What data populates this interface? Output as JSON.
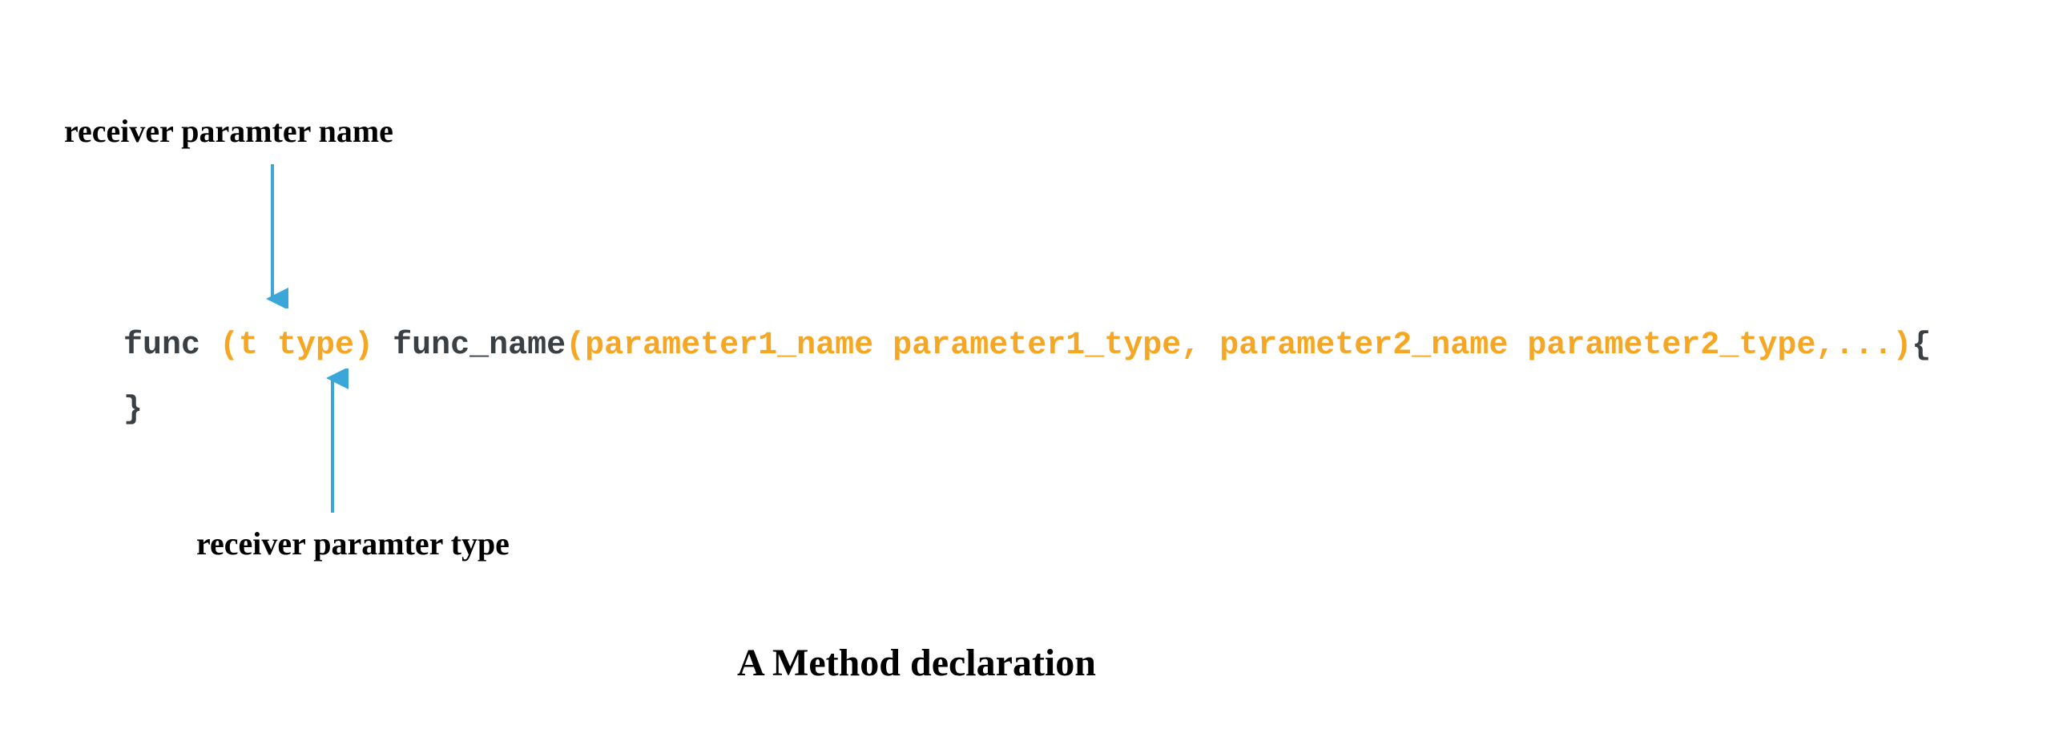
{
  "labels": {
    "top": "receiver paramter name",
    "bottom": "receiver paramter type"
  },
  "code": {
    "kw_func": "func ",
    "receiver": "(t type)",
    "sp1": " ",
    "fname": "func_name",
    "params": "(parameter1_name parameter1_type, parameter2_name parameter2_type,...)",
    "brace_open": "{",
    "brace_close": "}"
  },
  "caption": "A Method declaration",
  "colors": {
    "arrow": "#3aa7d8",
    "orange": "#f5a623",
    "dark": "#3a3f44"
  }
}
